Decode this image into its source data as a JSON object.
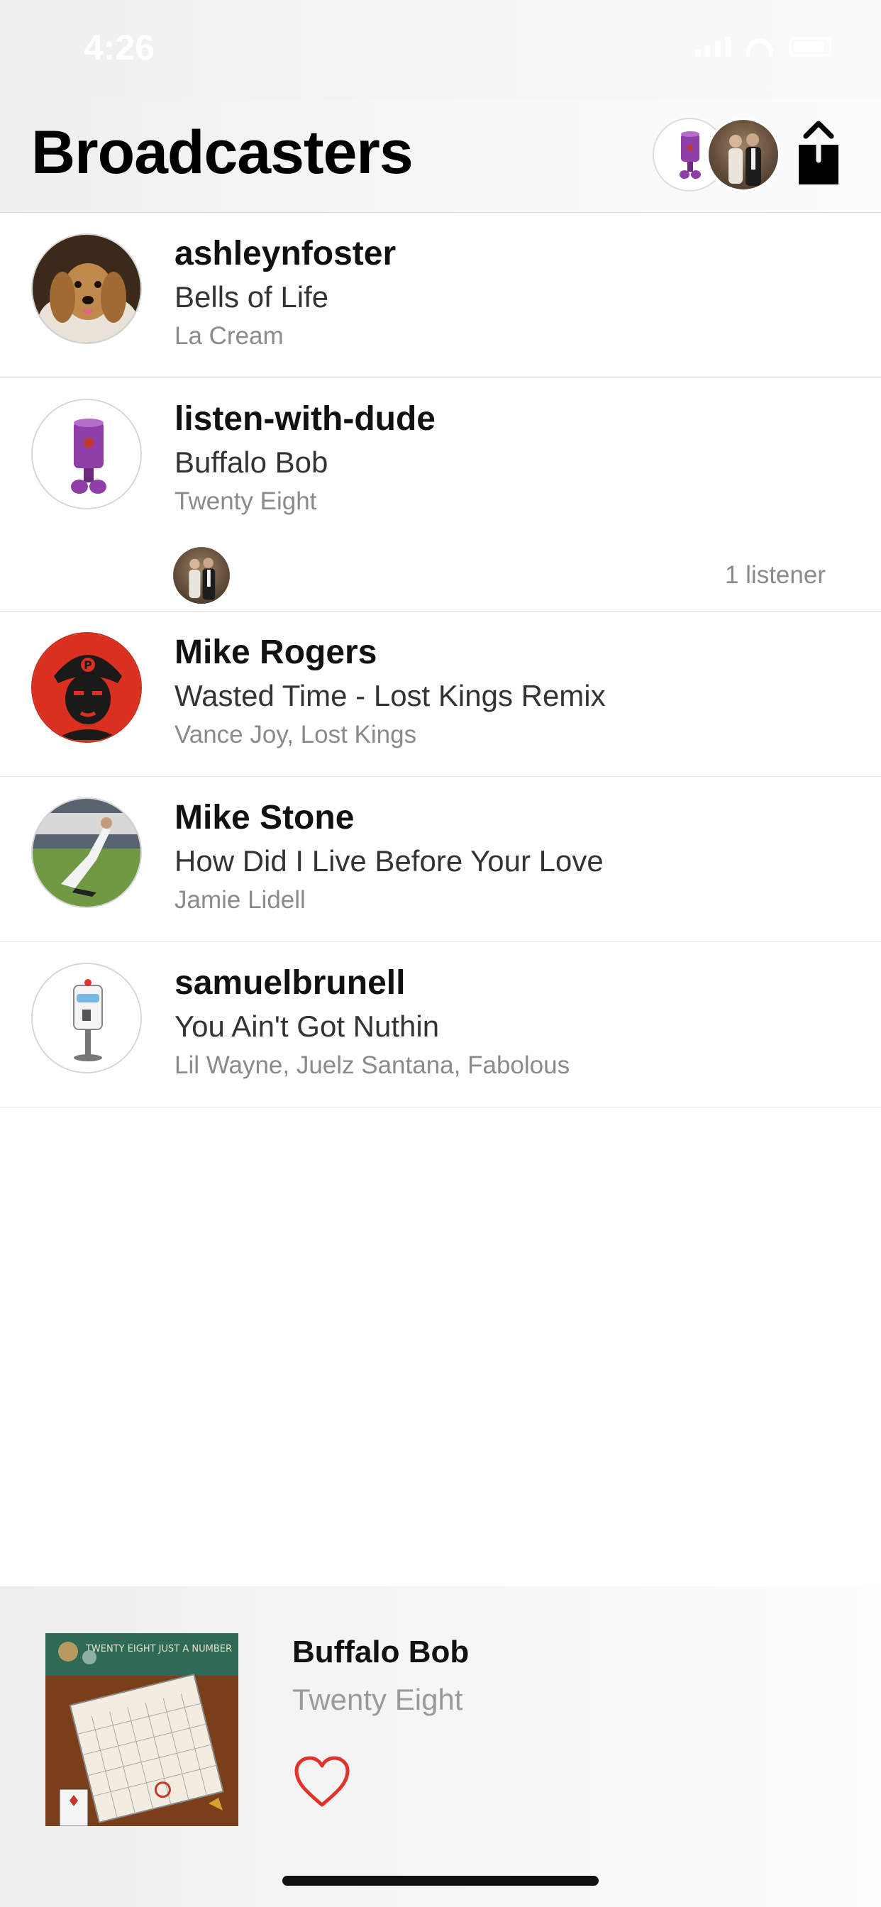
{
  "status_bar": {
    "time": "4:26"
  },
  "header": {
    "title": "Broadcasters"
  },
  "broadcasters": [
    {
      "name": "ashleynfoster",
      "song": "Bells of Life",
      "artist": "La Cream"
    },
    {
      "name": "listen-with-dude",
      "song": "Buffalo Bob",
      "artist": "Twenty Eight",
      "listeners": "1 listener"
    },
    {
      "name": "Mike Rogers",
      "song": "Wasted Time - Lost Kings Remix",
      "artist": "Vance Joy, Lost Kings"
    },
    {
      "name": "Mike Stone",
      "song": "How Did I Live Before Your Love",
      "artist": "Jamie Lidell"
    },
    {
      "name": "samuelbrunell",
      "song": "You Ain't Got Nuthin",
      "artist": "Lil Wayne, Juelz Santana, Fabolous"
    }
  ],
  "player": {
    "title": "Buffalo Bob",
    "artist": "Twenty Eight",
    "album_text": "TWENTY EIGHT JUST A NUMBER",
    "heart_color": "#e0332a"
  },
  "colors": {
    "accent": "#e0332a",
    "secondary_text": "#8a8a8a"
  }
}
